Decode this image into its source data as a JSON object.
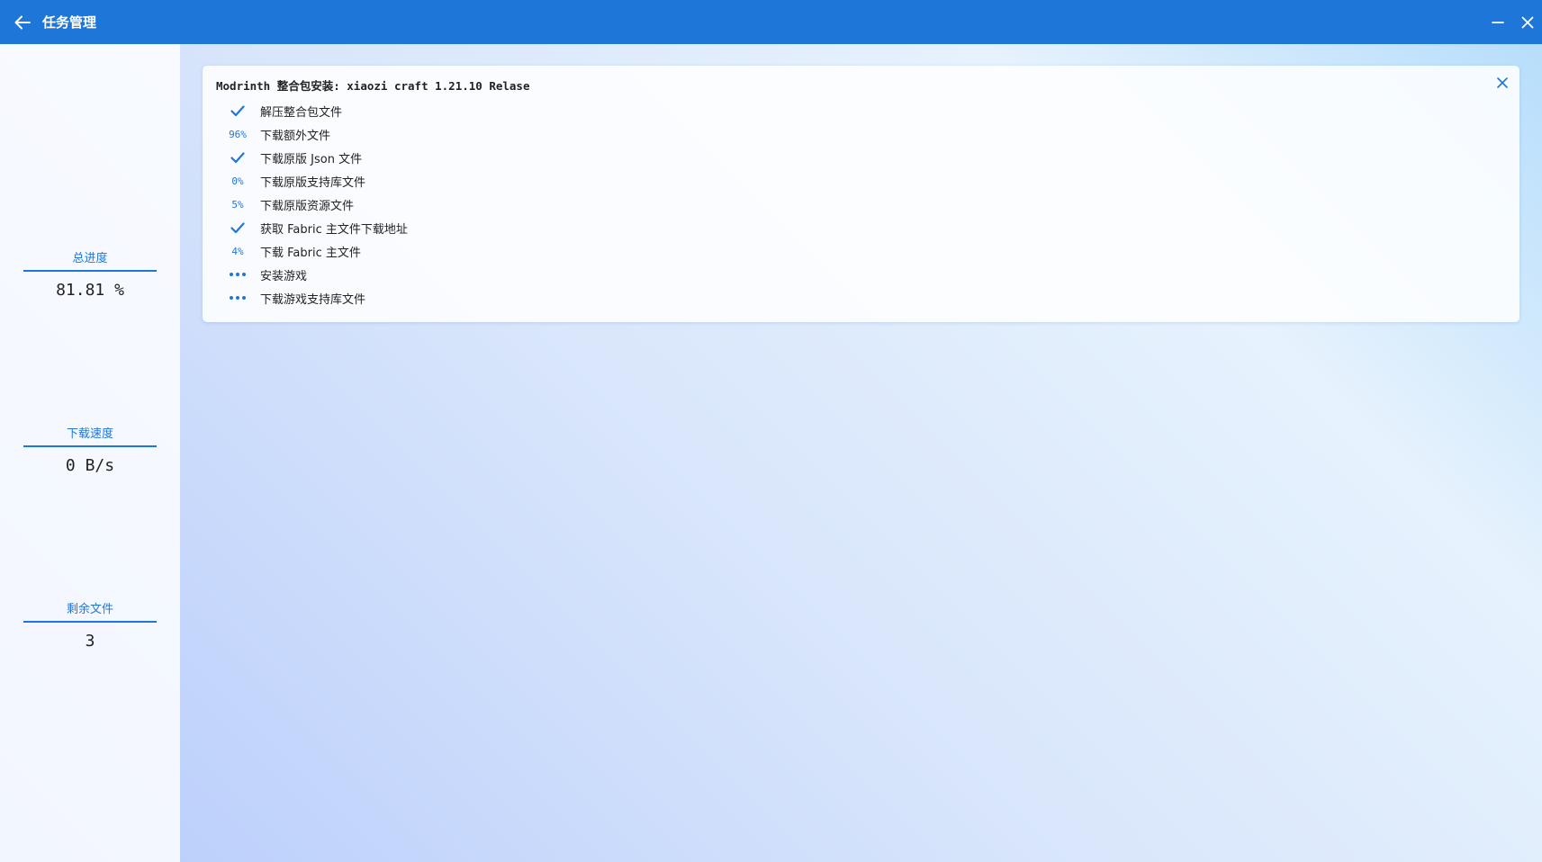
{
  "titlebar": {
    "title": "任务管理"
  },
  "sidebar": {
    "stats": [
      {
        "label": "总进度",
        "value": "81.81 %"
      },
      {
        "label": "下载速度",
        "value": "0 B/s"
      },
      {
        "label": "剩余文件",
        "value": "3"
      }
    ]
  },
  "task": {
    "title": "Modrinth 整合包安装: xiaozi craft 1.21.10 Relase",
    "steps": [
      {
        "status": "done",
        "status_text": "",
        "label": "解压整合包文件"
      },
      {
        "status": "progress",
        "status_text": "96%",
        "label": "下载额外文件"
      },
      {
        "status": "done",
        "status_text": "",
        "label": "下载原版 Json 文件"
      },
      {
        "status": "progress",
        "status_text": "0%",
        "label": "下载原版支持库文件"
      },
      {
        "status": "progress",
        "status_text": "5%",
        "label": "下载原版资源文件"
      },
      {
        "status": "done",
        "status_text": "",
        "label": "获取 Fabric 主文件下载地址"
      },
      {
        "status": "progress",
        "status_text": "4%",
        "label": "下载 Fabric 主文件"
      },
      {
        "status": "pending",
        "status_text": "",
        "label": "安装游戏"
      },
      {
        "status": "pending",
        "status_text": "",
        "label": "下载游戏支持库文件"
      }
    ]
  },
  "colors": {
    "accent": "#1f76d9",
    "titlebar_bg": "#1f76d9"
  },
  "icons": {
    "back": "arrow-left-icon",
    "minimize": "minimize-icon",
    "close": "close-icon",
    "done": "check-icon",
    "pending": "more-dots-icon"
  }
}
